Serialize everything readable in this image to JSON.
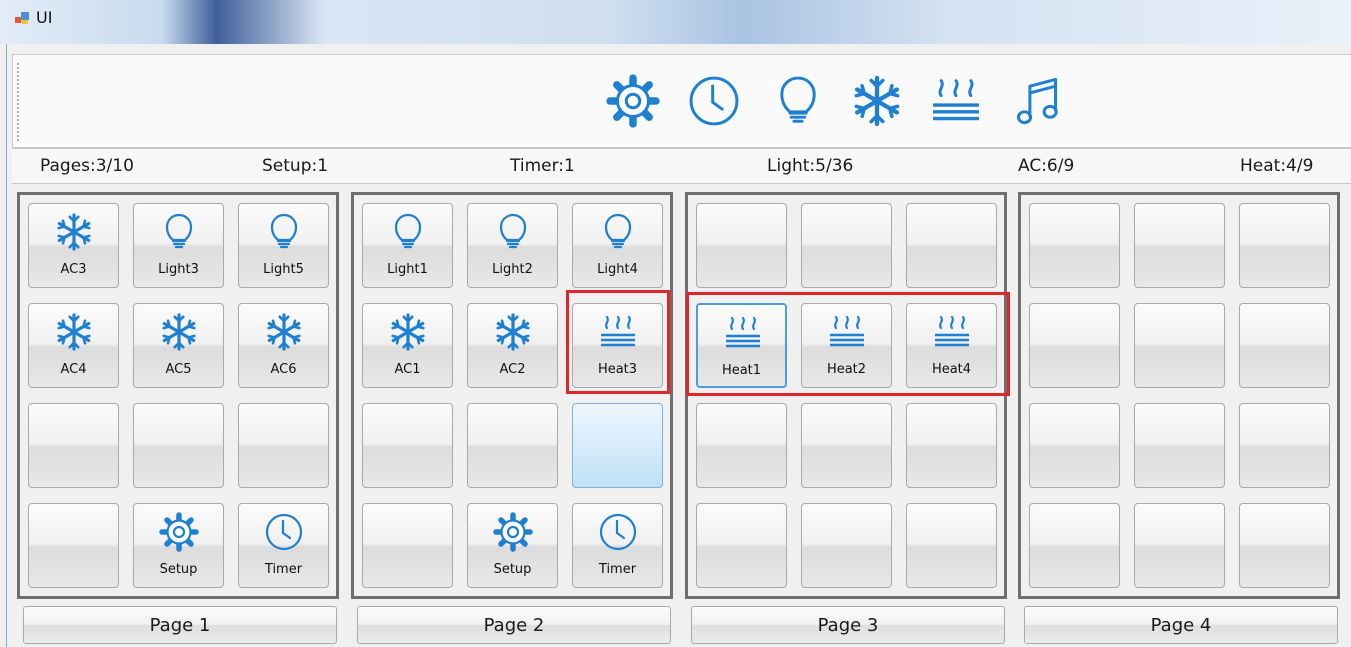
{
  "window": {
    "title": "UI"
  },
  "toolbar": {
    "icons": [
      "gear-icon",
      "clock-icon",
      "lightbulb-icon",
      "snowflake-icon",
      "heat-icon",
      "music-icon"
    ]
  },
  "status": {
    "pages": "Pages:3/10",
    "setup": "Setup:1",
    "timer": "Timer:1",
    "light": "Light:5/36",
    "ac": "AC:6/9",
    "heat": "Heat:4/9"
  },
  "colors": {
    "icon_blue": "#1f7fd0",
    "highlight_red": "#e0262b"
  },
  "pages": [
    {
      "button": "Page 1",
      "tiles": [
        {
          "icon": "snowflake-icon",
          "label": "AC3"
        },
        {
          "icon": "lightbulb-icon",
          "label": "Light3"
        },
        {
          "icon": "lightbulb-icon",
          "label": "Light5"
        },
        {
          "icon": "snowflake-icon",
          "label": "AC4"
        },
        {
          "icon": "snowflake-icon",
          "label": "AC5"
        },
        {
          "icon": "snowflake-icon",
          "label": "AC6"
        },
        {
          "icon": "",
          "label": ""
        },
        {
          "icon": "",
          "label": ""
        },
        {
          "icon": "",
          "label": ""
        },
        {
          "icon": "",
          "label": ""
        },
        {
          "icon": "gear-icon",
          "label": "Setup"
        },
        {
          "icon": "clock-icon",
          "label": "Timer"
        }
      ]
    },
    {
      "button": "Page 2",
      "tiles": [
        {
          "icon": "lightbulb-icon",
          "label": "Light1"
        },
        {
          "icon": "lightbulb-icon",
          "label": "Light2"
        },
        {
          "icon": "lightbulb-icon",
          "label": "Light4"
        },
        {
          "icon": "snowflake-icon",
          "label": "AC1"
        },
        {
          "icon": "snowflake-icon",
          "label": "AC2"
        },
        {
          "icon": "heat-icon",
          "label": "Heat3"
        },
        {
          "icon": "",
          "label": ""
        },
        {
          "icon": "",
          "label": ""
        },
        {
          "icon": "",
          "label": "",
          "highlighted": true
        },
        {
          "icon": "",
          "label": ""
        },
        {
          "icon": "gear-icon",
          "label": "Setup"
        },
        {
          "icon": "clock-icon",
          "label": "Timer"
        }
      ]
    },
    {
      "button": "Page 3",
      "tiles": [
        {
          "icon": "",
          "label": ""
        },
        {
          "icon": "",
          "label": ""
        },
        {
          "icon": "",
          "label": ""
        },
        {
          "icon": "heat-icon",
          "label": "Heat1",
          "selected": true
        },
        {
          "icon": "heat-icon",
          "label": "Heat2"
        },
        {
          "icon": "heat-icon",
          "label": "Heat4"
        },
        {
          "icon": "",
          "label": ""
        },
        {
          "icon": "",
          "label": ""
        },
        {
          "icon": "",
          "label": ""
        },
        {
          "icon": "",
          "label": ""
        },
        {
          "icon": "",
          "label": ""
        },
        {
          "icon": "",
          "label": ""
        }
      ]
    },
    {
      "button": "Page 4",
      "tiles": [
        {
          "icon": "",
          "label": ""
        },
        {
          "icon": "",
          "label": ""
        },
        {
          "icon": "",
          "label": ""
        },
        {
          "icon": "",
          "label": ""
        },
        {
          "icon": "",
          "label": ""
        },
        {
          "icon": "",
          "label": ""
        },
        {
          "icon": "",
          "label": ""
        },
        {
          "icon": "",
          "label": ""
        },
        {
          "icon": "",
          "label": ""
        },
        {
          "icon": "",
          "label": ""
        },
        {
          "icon": "",
          "label": ""
        },
        {
          "icon": "",
          "label": ""
        }
      ]
    }
  ]
}
